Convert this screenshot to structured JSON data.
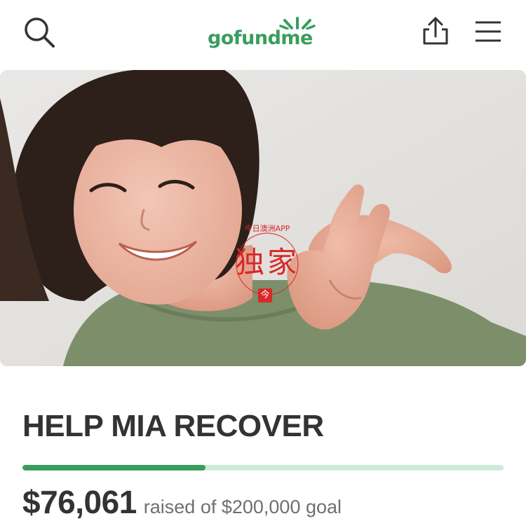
{
  "header": {
    "logo_text": "gofundme",
    "icons": {
      "search": "search-icon",
      "share": "share-icon",
      "menu": "hamburger-menu-icon"
    },
    "brand_color": "#3a9d5d"
  },
  "hero": {
    "alt": "Smiling woman with bob haircut making a peace sign",
    "watermark": {
      "arc_text": "今日澳洲APP",
      "main_text": "独家",
      "mark_text": "今",
      "color": "#d8282a"
    }
  },
  "campaign": {
    "title": "HELP MIA RECOVER",
    "raised": "$76,061",
    "raised_suffix": "raised of $200,000 goal",
    "progress_fraction": 0.38,
    "colors": {
      "progress_fill": "#3a9d5d",
      "progress_track": "#cdebd7"
    }
  }
}
